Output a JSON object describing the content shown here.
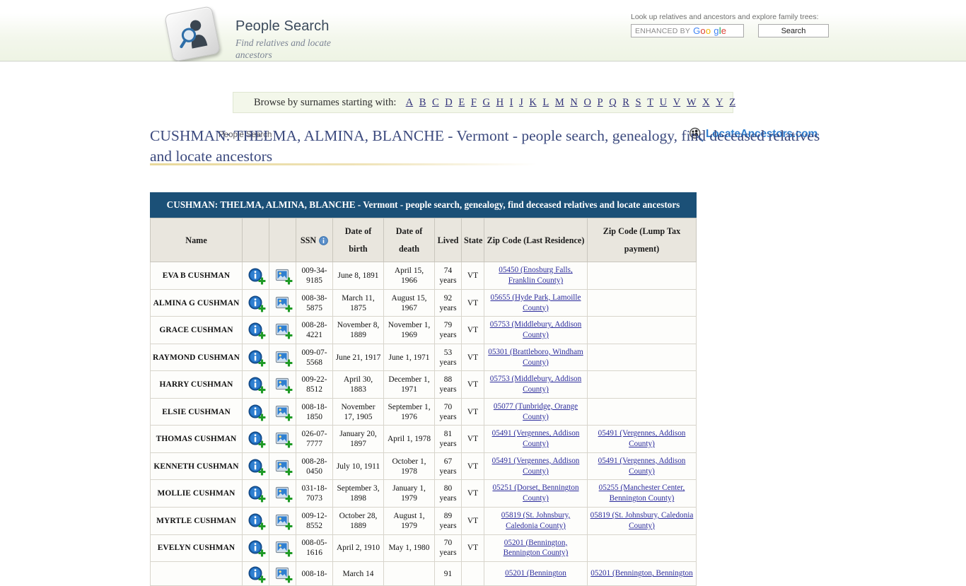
{
  "header": {
    "brand_title": "People Search",
    "brand_tagline": "Find relatives and locate ancestors",
    "logo_icon": "magnifier-person-key-icon",
    "search_label": "Look up relatives and ancestors and explore family trees:",
    "search_input_value": "",
    "search_input_branding_prefix": "ENHANCED BY",
    "search_input_branding_brand": "Google",
    "search_button_label": "Search"
  },
  "breadcrumb": {
    "items": [
      "People Search"
    ]
  },
  "site_logo": {
    "text": "LocateAncestors.com",
    "icon": "magnifier-people-icon",
    "color": "#2f7fd0"
  },
  "alpha_bar": {
    "label": "Browse by surnames starting with:",
    "letters": [
      "A",
      "B",
      "C",
      "D",
      "E",
      "F",
      "G",
      "H",
      "I",
      "J",
      "K",
      "L",
      "M",
      "N",
      "O",
      "P",
      "Q",
      "R",
      "S",
      "T",
      "U",
      "V",
      "W",
      "X",
      "Y",
      "Z"
    ]
  },
  "page": {
    "heading": "CUSHMAN: THELMA, ALMINA, BLANCHE - Vermont - people search, genealogy, find deceased relatives and locate ancestors"
  },
  "table": {
    "caption": "CUSHMAN: THELMA, ALMINA, BLANCHE - Vermont - people search, genealogy, find deceased relatives and locate ancestors",
    "header_bg": "#1b5077",
    "columns": [
      {
        "label": "Name",
        "key": "name"
      },
      {
        "label": "",
        "key": "icon_info"
      },
      {
        "label": "",
        "key": "icon_photo"
      },
      {
        "label": "SSN",
        "key": "ssn",
        "has_info_icon": true
      },
      {
        "label": "Date of birth",
        "key": "dob"
      },
      {
        "label": "Date of death",
        "key": "dod"
      },
      {
        "label": "Lived",
        "key": "lived"
      },
      {
        "label": "State",
        "key": "state"
      },
      {
        "label": "Zip Code (Last Residence)",
        "key": "zip_residence"
      },
      {
        "label": "Zip Code (Lump Tax payment)",
        "key": "zip_lumptax"
      }
    ],
    "rows": [
      {
        "name": "EVA B CUSHMAN",
        "ssn": "009-34-9185",
        "dob": "June 8, 1891",
        "dod": "April 15, 1966",
        "lived": "74 years",
        "state": "VT",
        "zip_residence": "05450 (Enosburg Falls, Franklin County)",
        "zip_lumptax": ""
      },
      {
        "name": "ALMINA G CUSHMAN",
        "ssn": "008-38-5875",
        "dob": "March 11, 1875",
        "dod": "August 15, 1967",
        "lived": "92 years",
        "state": "VT",
        "zip_residence": "05655 (Hyde Park, Lamoille County)",
        "zip_lumptax": ""
      },
      {
        "name": "GRACE CUSHMAN",
        "ssn": "008-28-4221",
        "dob": "November 8, 1889",
        "dod": "November 1, 1969",
        "lived": "79 years",
        "state": "VT",
        "zip_residence": "05753 (Middlebury, Addison County)",
        "zip_lumptax": ""
      },
      {
        "name": "RAYMOND CUSHMAN",
        "ssn": "009-07-5568",
        "dob": "June 21, 1917",
        "dod": "June 1, 1971",
        "lived": "53 years",
        "state": "VT",
        "zip_residence": "05301 (Brattleboro, Windham County)",
        "zip_lumptax": ""
      },
      {
        "name": "HARRY CUSHMAN",
        "ssn": "009-22-8512",
        "dob": "April 30, 1883",
        "dod": "December 1, 1971",
        "lived": "88 years",
        "state": "VT",
        "zip_residence": "05753 (Middlebury, Addison County)",
        "zip_lumptax": ""
      },
      {
        "name": "ELSIE CUSHMAN",
        "ssn": "008-18-1850",
        "dob": "November 17, 1905",
        "dod": "September 1, 1976",
        "lived": "70 years",
        "state": "VT",
        "zip_residence": "05077 (Tunbridge, Orange County)",
        "zip_lumptax": ""
      },
      {
        "name": "THOMAS CUSHMAN",
        "ssn": "026-07-7777",
        "dob": "January 20, 1897",
        "dod": "April 1, 1978",
        "lived": "81 years",
        "state": "VT",
        "zip_residence": "05491 (Vergennes, Addison County)",
        "zip_lumptax": "05491 (Vergennes, Addison County)"
      },
      {
        "name": "KENNETH CUSHMAN",
        "ssn": "008-28-0450",
        "dob": "July 10, 1911",
        "dod": "October 1, 1978",
        "lived": "67 years",
        "state": "VT",
        "zip_residence": "05491 (Vergennes, Addison County)",
        "zip_lumptax": "05491 (Vergennes, Addison County)"
      },
      {
        "name": "MOLLIE CUSHMAN",
        "ssn": "031-18-7073",
        "dob": "September 3, 1898",
        "dod": "January 1, 1979",
        "lived": "80 years",
        "state": "VT",
        "zip_residence": "05251 (Dorset, Bennington County)",
        "zip_lumptax": "05255 (Manchester Center, Bennington County)"
      },
      {
        "name": "MYRTLE CUSHMAN",
        "ssn": "009-12-8552",
        "dob": "October 28, 1889",
        "dod": "August 1, 1979",
        "lived": "89 years",
        "state": "VT",
        "zip_residence": "05819 (St. Johnsbury, Caledonia County)",
        "zip_lumptax": "05819 (St. Johnsbury, Caledonia County)"
      },
      {
        "name": "EVELYN CUSHMAN",
        "ssn": "008-05-1616",
        "dob": "April 2, 1910",
        "dod": "May 1, 1980",
        "lived": "70 years",
        "state": "VT",
        "zip_residence": "05201 (Bennington, Bennington County)",
        "zip_lumptax": ""
      },
      {
        "name": "",
        "ssn": "008-18-",
        "dob": "March 14",
        "dod": "",
        "lived": "91",
        "state": "",
        "zip_residence": "05201 (Bennington",
        "zip_lumptax": "05201 (Bennington, Bennington"
      }
    ]
  },
  "icons": {
    "info_add": "info-add-icon",
    "photo_add": "photo-add-icon",
    "ssn_info": "info-icon"
  }
}
